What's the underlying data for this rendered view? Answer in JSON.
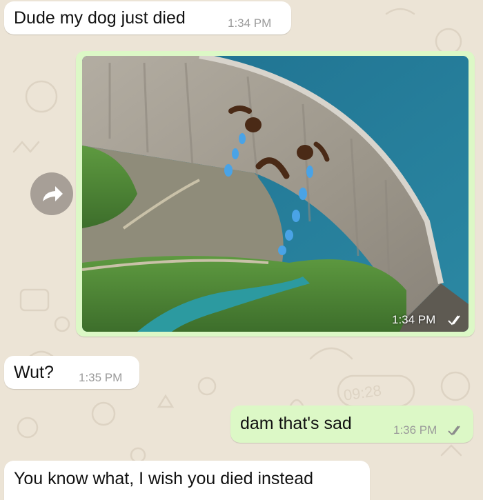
{
  "colors": {
    "wallpaper": "#ece4d6",
    "incoming_bubble": "#ffffff",
    "outgoing_bubble": "#dcf8c6",
    "water": "#2a7a8f",
    "dam_concrete": "#a39e92",
    "forest": "#4f8a3a",
    "cartoon_face": "#4a2a16",
    "tears": "#4aa3e6",
    "read_ticks": "#8c8c8c"
  },
  "icons": {
    "forward": "forward-arrow-icon",
    "read_receipt": "double-check-icon"
  },
  "messages": [
    {
      "direction": "incoming",
      "type": "text",
      "text": "Dude my dog just died",
      "time": "1:34 PM"
    },
    {
      "direction": "outgoing",
      "type": "image",
      "image_description": "dam-with-crying-face-photo",
      "time": "1:34 PM",
      "status": "read"
    },
    {
      "direction": "incoming",
      "type": "text",
      "text": "Wut?",
      "time": "1:35 PM"
    },
    {
      "direction": "outgoing",
      "type": "text",
      "text": "dam that's sad",
      "time": "1:36 PM",
      "status": "read"
    },
    {
      "direction": "incoming",
      "type": "text",
      "text": "You know what, I wish you died instead",
      "time": ""
    }
  ]
}
